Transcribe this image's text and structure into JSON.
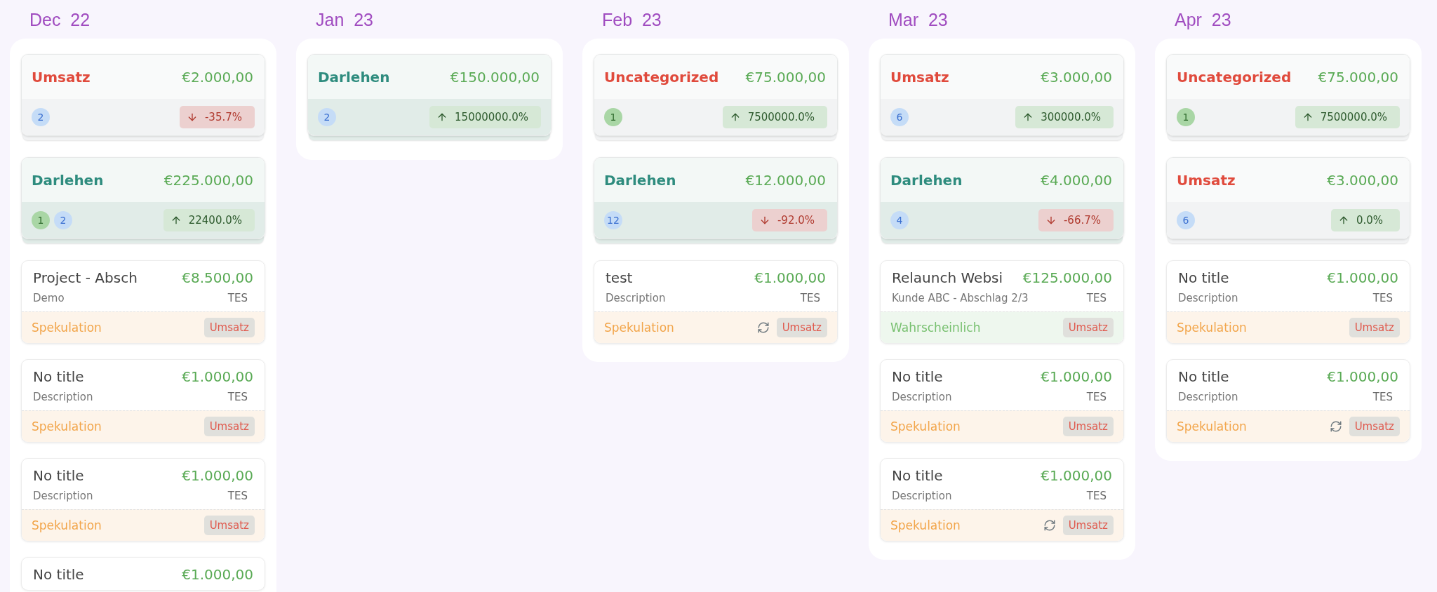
{
  "columns": [
    {
      "month": "Dec  22",
      "groups": [
        {
          "category": "Umsatz",
          "color": "#e04a3c",
          "amount": "€2.000,00",
          "counts": [
            {
              "value": "2",
              "color": "#c5dcf7"
            }
          ],
          "rising": false,
          "change": "-35.7%"
        },
        {
          "category": "Darlehen",
          "color": "#2e8c7e",
          "amount": "€225.000,00",
          "counts": [
            {
              "value": "1",
              "color": "#a9d6a5"
            },
            {
              "value": "2",
              "color": "#c5dcf7"
            }
          ],
          "rising": true,
          "change": "22400.0%"
        }
      ],
      "entries": [
        {
          "title": "Project - Absch",
          "amount": "€8.500,00",
          "description": "Demo",
          "code": "TES",
          "status": "Spekulation",
          "color": "#f2a54a",
          "recurring": false,
          "tag": "Umsatz"
        },
        {
          "title": "No title",
          "amount": "€1.000,00",
          "description": "Description",
          "code": "TES",
          "status": "Spekulation",
          "color": "#f2a54a",
          "recurring": false,
          "tag": "Umsatz"
        },
        {
          "title": "No title",
          "amount": "€1.000,00",
          "description": "Description",
          "code": "TES",
          "status": "Spekulation",
          "color": "#f2a54a",
          "recurring": false,
          "tag": "Umsatz"
        },
        {
          "title": "No title",
          "amount": "€1.000,00"
        }
      ]
    },
    {
      "month": "Jan  23",
      "groups": [
        {
          "category": "Darlehen",
          "color": "#2e8c7e",
          "amount": "€150.000,00",
          "counts": [
            {
              "value": "2",
              "color": "#c5dcf7"
            }
          ],
          "rising": true,
          "change": "15000000.0%"
        }
      ]
    },
    {
      "month": "Feb  23",
      "groups": [
        {
          "category": "Uncategorized",
          "color": "#e04a3c",
          "amount": "€75.000,00",
          "counts": [
            {
              "value": "1",
              "color": "#a9d6a5"
            }
          ],
          "rising": true,
          "change": "7500000.0%"
        },
        {
          "category": "Darlehen",
          "color": "#2e8c7e",
          "amount": "€12.000,00",
          "counts": [
            {
              "value": "12",
              "color": "#c5dcf7"
            }
          ],
          "rising": false,
          "change": "-92.0%"
        }
      ],
      "entries": [
        {
          "title": "test",
          "amount": "€1.000,00",
          "description": "Description",
          "code": "TES",
          "status": "Spekulation",
          "color": "#f2a54a",
          "recurring": true,
          "tag": "Umsatz"
        }
      ]
    },
    {
      "month": "Mar  23",
      "groups": [
        {
          "category": "Umsatz",
          "color": "#e04a3c",
          "amount": "€3.000,00",
          "counts": [
            {
              "value": "6",
              "color": "#c5dcf7"
            }
          ],
          "rising": true,
          "change": "300000.0%"
        },
        {
          "category": "Darlehen",
          "color": "#2e8c7e",
          "amount": "€4.000,00",
          "counts": [
            {
              "value": "4",
              "color": "#c5dcf7"
            }
          ],
          "rising": false,
          "change": "-66.7%"
        }
      ],
      "entries": [
        {
          "title": "Relaunch Websi",
          "amount": "€125.000,00",
          "description": "Kunde ABC - Abschlag 2/3",
          "code": "TES",
          "status": "Wahrscheinlich",
          "color": "#78c070",
          "recurring": false,
          "tag": "Umsatz"
        },
        {
          "title": "No title",
          "amount": "€1.000,00",
          "description": "Description",
          "code": "TES",
          "status": "Spekulation",
          "color": "#f2a54a",
          "recurring": false,
          "tag": "Umsatz"
        },
        {
          "title": "No title",
          "amount": "€1.000,00",
          "description": "Description",
          "code": "TES",
          "status": "Spekulation",
          "color": "#f2a54a",
          "recurring": true,
          "tag": "Umsatz"
        }
      ]
    },
    {
      "month": "Apr  23",
      "groups": [
        {
          "category": "Uncategorized",
          "color": "#e04a3c",
          "amount": "€75.000,00",
          "counts": [
            {
              "value": "1",
              "color": "#a9d6a5"
            }
          ],
          "rising": true,
          "change": "7500000.0%"
        },
        {
          "category": "Umsatz",
          "color": "#e04a3c",
          "amount": "€3.000,00",
          "counts": [
            {
              "value": "6",
              "color": "#c5dcf7"
            }
          ],
          "rising": true,
          "change": "0.0%"
        }
      ],
      "entries": [
        {
          "title": "No title",
          "amount": "€1.000,00",
          "description": "Description",
          "code": "TES",
          "status": "Spekulation",
          "color": "#f2a54a",
          "recurring": false,
          "tag": "Umsatz"
        },
        {
          "title": "No title",
          "amount": "€1.000,00",
          "description": "Description",
          "code": "TES",
          "status": "Spekulation",
          "color": "#f2a54a",
          "recurring": true,
          "tag": "Umsatz"
        }
      ]
    }
  ]
}
